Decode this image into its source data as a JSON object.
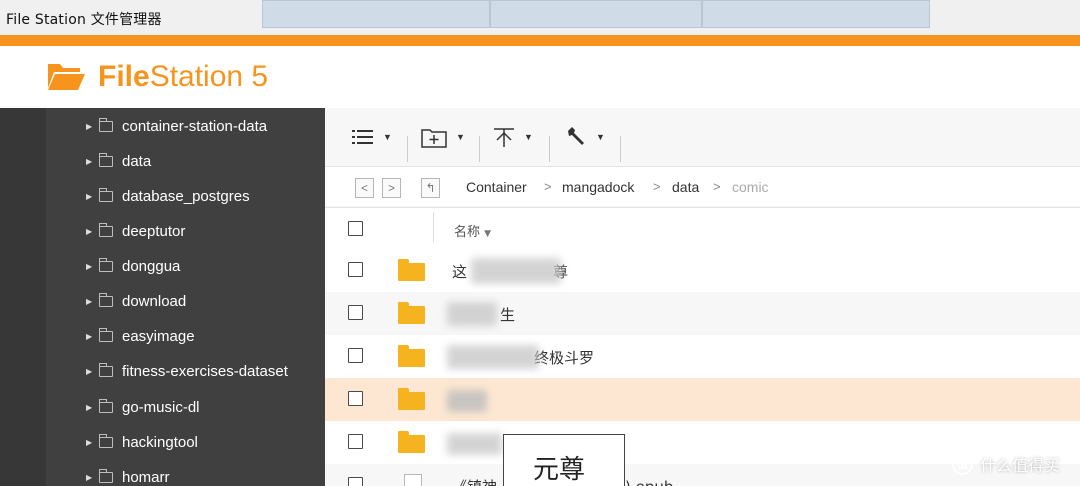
{
  "window": {
    "title": "File Station 文件管理器"
  },
  "app": {
    "name_bold": "File",
    "name_regular": "Station 5"
  },
  "sidebar": {
    "items": [
      {
        "label": "container-station-data"
      },
      {
        "label": "data"
      },
      {
        "label": "database_postgres"
      },
      {
        "label": "deeptutor"
      },
      {
        "label": "donggua"
      },
      {
        "label": "download"
      },
      {
        "label": "easyimage"
      },
      {
        "label": "fitness-exercises-dataset"
      },
      {
        "label": "go-music-dl"
      },
      {
        "label": "hackingtool"
      },
      {
        "label": "homarr"
      }
    ]
  },
  "toolbar": {
    "view_icon": "list-view-icon",
    "new_folder_icon": "new-folder-icon",
    "upload_icon": "upload-icon",
    "tools_icon": "wrench-icon"
  },
  "breadcrumb": {
    "items": [
      {
        "label": "Container"
      },
      {
        "label": "mangadock"
      },
      {
        "label": "data"
      },
      {
        "label": "comic"
      }
    ]
  },
  "list": {
    "column_name": "名称",
    "rows": [
      {
        "name": "这",
        "suffix": "尊",
        "type": "folder",
        "selected": false
      },
      {
        "name": "",
        "suffix": "生",
        "type": "folder",
        "selected": false
      },
      {
        "name": "",
        "suffix": "终极斗罗",
        "type": "folder",
        "selected": false
      },
      {
        "name": "",
        "suffix": "",
        "type": "folder",
        "selected": true
      },
      {
        "name": "",
        "suffix": "",
        "type": "folder",
        "selected": false
      },
      {
        "name": "《镇神",
        "suffix": ").epub",
        "type": "file",
        "selected": false
      }
    ]
  },
  "tooltip": {
    "text": "元尊"
  },
  "watermark": {
    "badge": "值",
    "text": "什么值得买"
  },
  "colors": {
    "accent": "#f7941d",
    "sidebar_bg": "#404040",
    "folder": "#f5b41f",
    "selected_row": "#fde7d2"
  }
}
